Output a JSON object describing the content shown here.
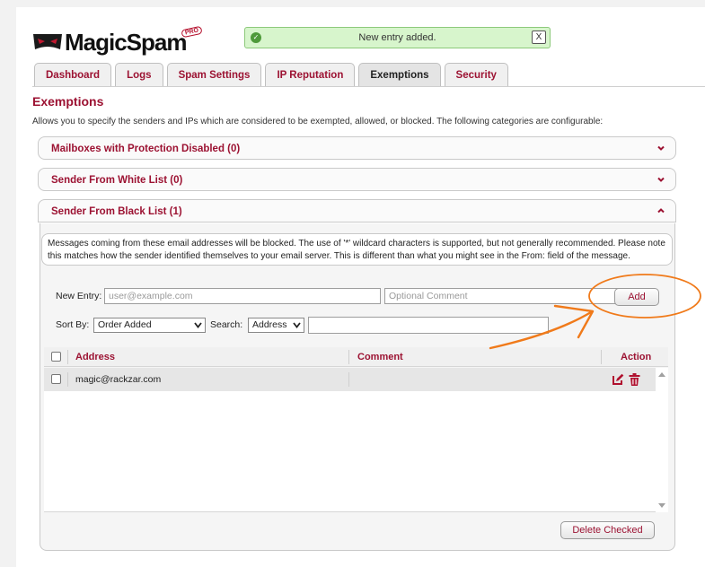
{
  "app": {
    "logo_text": "MagicSpam",
    "logo_badge": "PRO"
  },
  "notification": {
    "text": "New entry added.",
    "close_label": "X"
  },
  "tabs": [
    {
      "label": "Dashboard"
    },
    {
      "label": "Logs"
    },
    {
      "label": "Spam Settings"
    },
    {
      "label": "IP Reputation"
    },
    {
      "label": "Exemptions"
    },
    {
      "label": "Security"
    }
  ],
  "page": {
    "title": "Exemptions",
    "intro": "Allows you to specify the senders and IPs which are considered to be exempted, allowed, or blocked. The following categories are configurable:"
  },
  "sections": [
    {
      "label": "Mailboxes with Protection Disabled (0)"
    },
    {
      "label": "Sender From White List (0)"
    },
    {
      "label": "Sender From Black List (1)"
    }
  ],
  "blacklist": {
    "description_line1": "Messages coming from these email addresses will be blocked. The use of '*' wildcard characters is supported, but not generally recommended. Please note",
    "description_line2": "this matches how the sender identified themselves to your email server. This is different than what you might see in the From: field of the message.",
    "new_entry_label": "New Entry:",
    "new_entry_placeholder": "user@example.com",
    "comment_placeholder": "Optional Comment",
    "add_button": "Add",
    "sort_label": "Sort By:",
    "sort_value": "Order Added",
    "search_label": "Search:",
    "search_field_value": "Address",
    "search_value": "",
    "columns": {
      "address": "Address",
      "comment": "Comment",
      "action": "Action"
    },
    "rows": [
      {
        "address": "magic@rackzar.com",
        "comment": ""
      }
    ],
    "delete_button": "Delete Checked"
  },
  "colors": {
    "accent": "#9c1232",
    "notification_bg": "#d7f5cc",
    "annotation": "#f07a1a"
  }
}
